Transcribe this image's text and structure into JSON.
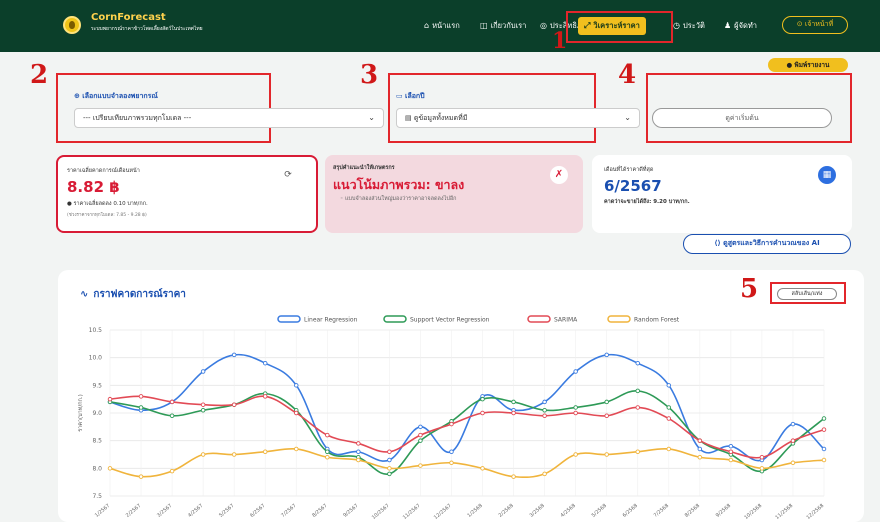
{
  "nav": {
    "brand_title": "CornForecast",
    "brand_subtitle": "ระบบพยากรณ์ราคาข้าวโพดเลี้ยงสัตว์ในประเทศไทย",
    "items": [
      {
        "icon": "⌂",
        "label": "หน้าแรก"
      },
      {
        "icon": "◫",
        "label": "เกี่ยวกับเรา"
      },
      {
        "icon": "◎",
        "label": "ประสิทธิภาพ"
      },
      {
        "icon": "⤢",
        "label": "วิเคราะห์ราคา"
      },
      {
        "icon": "◷",
        "label": "ประวัติ"
      },
      {
        "icon": "♟",
        "label": "ผู้จัดทำ"
      }
    ],
    "officer_label": "⊙ เจ้าหน้าที่"
  },
  "print_label": "● พิมพ์รายงาน",
  "annotations": [
    "1",
    "2",
    "3",
    "4",
    "5"
  ],
  "controls": {
    "model_label": "⊕ เลือกแบบจำลองพยากรณ์",
    "model_value": "--- เปรียบเทียบภาพรวมทุกโมเดล ---",
    "year_label": "▭ เลือกปี",
    "year_value": "▤ ดูข้อมูลทั้งหมดที่มี",
    "start_button": "ดูค่าเริ่มต้น"
  },
  "cards": {
    "avg": {
      "title": "ราคาเฉลี่ยคาดการณ์เดือนหน้า",
      "value": "8.82 ฿",
      "change": "● ราคาเฉลี่ยลดลง 0.10 บาท/กก.",
      "range": "(ช่วงราคาจากทุกโมเดล: 7.85 - 9.28 ฿)"
    },
    "trend": {
      "title": "สรุปคำแนะนำให้เกษตรกร",
      "value": "แนวโน้มภาพรวม: ขาลง",
      "desc": "◦ แบบจำลองส่วนใหญ่มองว่าราคาอาจลดลงไปอีก"
    },
    "best": {
      "title": "เดือนที่ได้ราคาดีที่สุด",
      "value": "6/2567",
      "desc": "คาดว่าจะขายได้ถึง: 9.20 บาท/กก."
    }
  },
  "ai_button": "⟨⟩ ดูสูตรและวิธีการคำนวณของ AI",
  "chart": {
    "title": "กราฟคาดการณ์ราคา",
    "toggle_label": "สลับเส้น/แท่ง"
  },
  "chart_data": {
    "type": "line",
    "ylabel": "ราคา(บาท/กก.)",
    "ylim": [
      7.5,
      10.5
    ],
    "yticks": [
      "7.5",
      "8.0",
      "8.5",
      "9.0",
      "9.5",
      "10.0",
      "10.5"
    ],
    "categories": [
      "1/2567",
      "2/2567",
      "3/2567",
      "4/2567",
      "5/2567",
      "6/2567",
      "7/2567",
      "8/2567",
      "9/2567",
      "10/2567",
      "11/2567",
      "12/2567",
      "1/2568",
      "2/2568",
      "3/2568",
      "4/2568",
      "5/2568",
      "6/2568",
      "7/2568",
      "8/2568",
      "9/2568",
      "10/2568",
      "11/2568",
      "12/2568"
    ],
    "series": [
      {
        "name": "Linear Regression",
        "color": "#3a7be0",
        "values": [
          9.2,
          9.05,
          9.2,
          9.75,
          10.05,
          9.9,
          9.5,
          8.35,
          8.3,
          8.15,
          8.75,
          8.3,
          9.3,
          9.05,
          9.2,
          9.75,
          10.05,
          9.9,
          9.5,
          8.35,
          8.4,
          8.15,
          8.8,
          8.35
        ]
      },
      {
        "name": "Support Vector Regression",
        "color": "#2e9a57",
        "values": [
          9.2,
          9.1,
          8.95,
          9.05,
          9.15,
          9.35,
          9.05,
          8.3,
          8.2,
          7.9,
          8.5,
          8.85,
          9.25,
          9.2,
          9.05,
          9.1,
          9.2,
          9.4,
          9.1,
          8.5,
          8.25,
          7.95,
          8.45,
          8.9
        ]
      },
      {
        "name": "SARIMA",
        "color": "#e24a55",
        "values": [
          9.25,
          9.3,
          9.2,
          9.15,
          9.15,
          9.3,
          9.0,
          8.6,
          8.45,
          8.3,
          8.6,
          8.8,
          9.0,
          9.0,
          8.95,
          9.0,
          8.95,
          9.1,
          8.9,
          8.5,
          8.3,
          8.2,
          8.5,
          8.7
        ]
      },
      {
        "name": "Random Forest",
        "color": "#f0b43c",
        "values": [
          8.0,
          7.85,
          7.95,
          8.25,
          8.25,
          8.3,
          8.35,
          8.2,
          8.15,
          8.0,
          8.05,
          8.1,
          8.0,
          7.85,
          7.9,
          8.25,
          8.25,
          8.3,
          8.35,
          8.2,
          8.15,
          8.0,
          8.1,
          8.15
        ]
      }
    ],
    "grid": true,
    "legend": "top"
  }
}
